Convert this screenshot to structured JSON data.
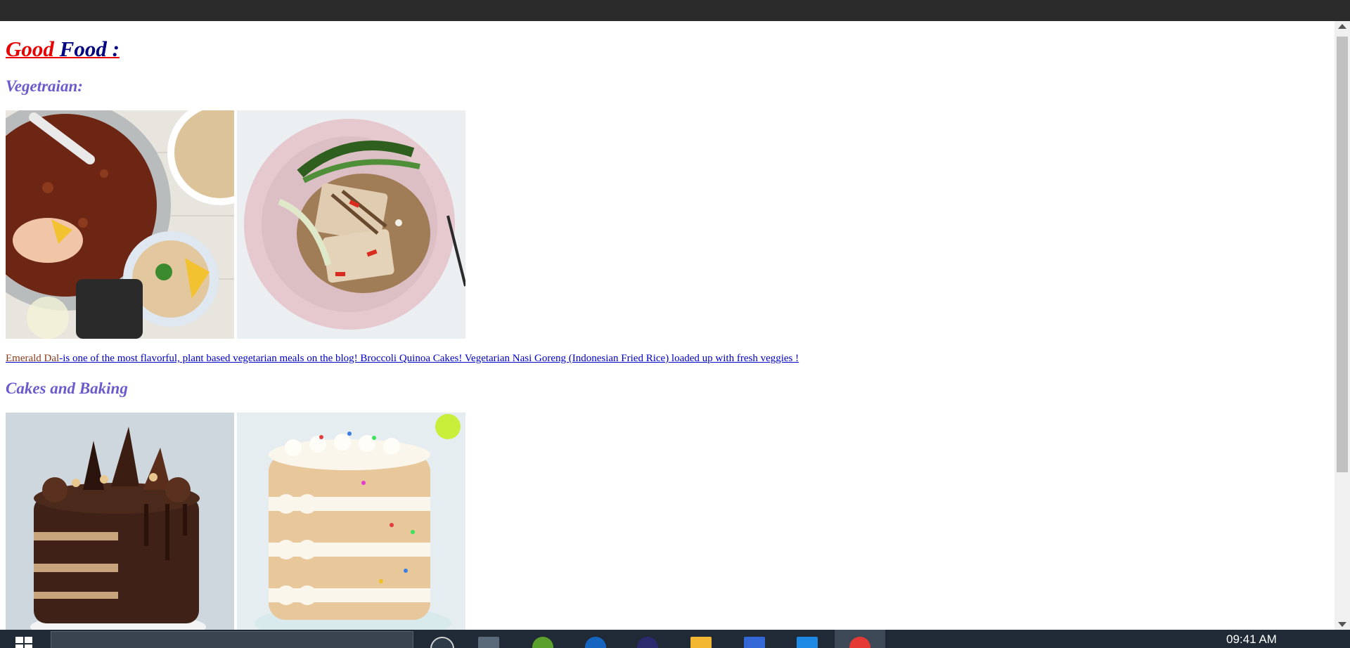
{
  "page": {
    "title_parts": [
      "Good",
      "Food",
      ":"
    ],
    "sections": [
      {
        "heading": "Vegetraian:"
      },
      {
        "heading": "Cakes and Baking"
      }
    ],
    "description": {
      "lead": "Emerald Dal",
      "rest": "-is one of the most flavorful, plant based vegetarian meals on the blog! Broccoli Quinoa Cakes! Vegetarian Nasi Goreng (Indonesian Fried Rice) loaded up with fresh veggies !"
    }
  },
  "taskbar": {
    "clock": "09:41 AM"
  }
}
